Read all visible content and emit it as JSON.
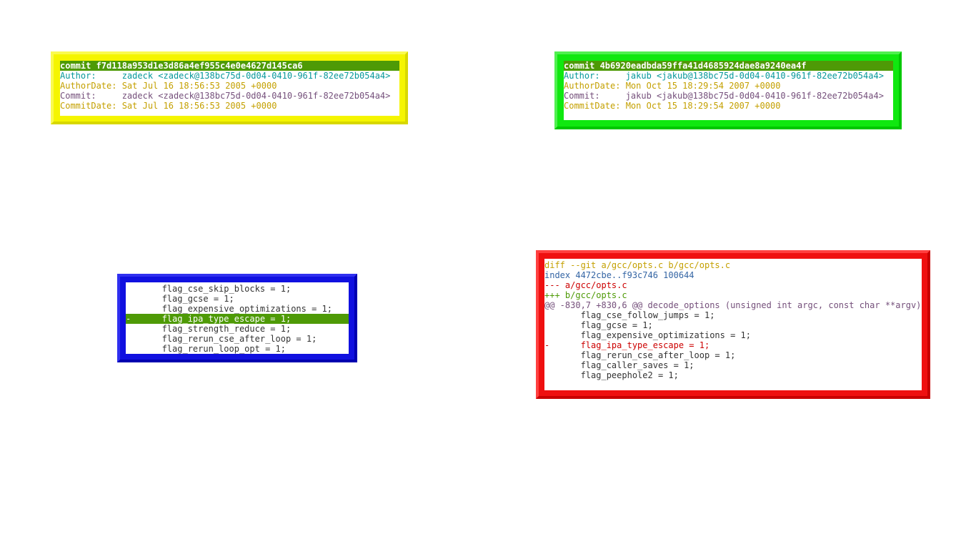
{
  "windows": {
    "yellow": {
      "lines": [
        "commit f7d118a953d1e3d86a4ef955c4e0e4627d145ca6",
        "Author:     zadeck <zadeck@138bc75d-0d04-0410-961f-82ee72b054a4>",
        "AuthorDate: Sat Jul 16 18:56:53 2005 +0000",
        "Commit:     zadeck <zadeck@138bc75d-0d04-0410-961f-82ee72b054a4>",
        "CommitDate: Sat Jul 16 18:56:53 2005 +0000"
      ]
    },
    "green": {
      "lines": [
        "commit 4b6920eadbda59ffa41d4685924dae8a9240ea4f",
        "Author:     jakub <jakub@138bc75d-0d04-0410-961f-82ee72b054a4>",
        "AuthorDate: Mon Oct 15 18:29:54 2007 +0000",
        "Commit:     jakub <jakub@138bc75d-0d04-0410-961f-82ee72b054a4>",
        "CommitDate: Mon Oct 15 18:29:54 2007 +0000"
      ]
    },
    "blue": {
      "lines": [
        "       flag_cse_skip_blocks = 1;",
        "       flag_gcse = 1;",
        "       flag_expensive_optimizations = 1;",
        "-      flag_ipa_type_escape = 1;",
        "       flag_strength_reduce = 1;",
        "       flag_rerun_cse_after_loop = 1;",
        "       flag_rerun_loop_opt = 1;"
      ]
    },
    "red": {
      "lines": [
        "diff --git a/gcc/opts.c b/gcc/opts.c",
        "index 4472cbe..f93c746 100644",
        "--- a/gcc/opts.c",
        "+++ b/gcc/opts.c",
        "@@ -830,7 +830,6 @@ decode_options (unsigned int argc, const char **argv)",
        "       flag_cse_follow_jumps = 1;",
        "       flag_gcse = 1;",
        "       flag_expensive_optimizations = 1;",
        "-      flag_ipa_type_escape = 1;",
        "       flag_rerun_cse_after_loop = 1;",
        "       flag_caller_saves = 1;",
        "       flag_peephole2 = 1;"
      ]
    }
  },
  "colors": {
    "yellow_frame": "#f5f500",
    "green_frame": "#10e810",
    "blue_frame": "#1010e0",
    "red_frame": "#ef1010",
    "highlight": "#4e9a06"
  }
}
